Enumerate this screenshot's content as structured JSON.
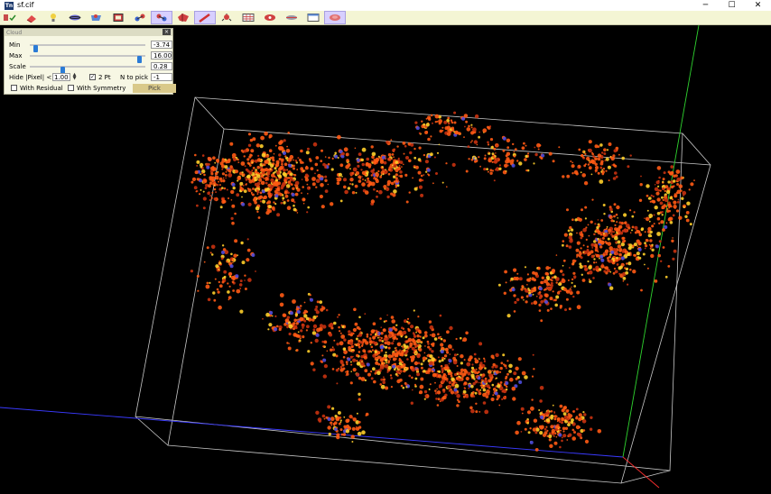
{
  "window": {
    "app_icon_text": "Tn",
    "title": "sf.cif",
    "minimize_glyph": "─",
    "maximize_glyph": "☐",
    "close_glyph": "✕"
  },
  "toolbar": {
    "buttons": [
      {
        "name": "structure-check-icon",
        "active": false
      },
      {
        "name": "eraser-icon",
        "active": false
      },
      {
        "name": "light-bulb-icon",
        "active": false
      },
      {
        "name": "ellipsoid-icon",
        "active": false
      },
      {
        "name": "packing-icon",
        "active": false
      },
      {
        "name": "unit-cell-box-icon",
        "active": false
      },
      {
        "name": "molecule-icon",
        "active": false
      },
      {
        "name": "atoms-selection-icon",
        "active": true
      },
      {
        "name": "polyhedron-icon",
        "active": false
      },
      {
        "name": "bond-pencil-icon",
        "active": true
      },
      {
        "name": "grow-tool-icon",
        "active": false
      },
      {
        "name": "grid-table-icon",
        "active": false
      },
      {
        "name": "hkl-view-icon",
        "active": false
      },
      {
        "name": "fourier-map-icon",
        "active": false
      },
      {
        "name": "window-layout-icon",
        "active": false
      },
      {
        "name": "cloud-density-icon",
        "active": true
      }
    ]
  },
  "panel": {
    "title": "Cloud",
    "close_glyph": "×",
    "min_label": "Min",
    "min_value": "-3.74",
    "min_slider_fraction": 0.03,
    "max_label": "Max",
    "max_value": "16.00",
    "max_slider_fraction": 0.97,
    "scale_label": "Scale",
    "scale_value": "0.28",
    "scale_slider_fraction": 0.28,
    "hide_label": "Hide |Pixel| <",
    "hide_value": "1.00",
    "two_pt_label": "2 Pt",
    "two_pt_checked": true,
    "check_glyph": "✓",
    "n_to_pick_label": "N to pick",
    "n_to_pick_value": "-1",
    "with_residual_label": "With Residual",
    "with_residual_checked": false,
    "with_symmetry_label": "With Symmetry",
    "with_symmetry_checked": false,
    "pick_label": "Pick"
  },
  "colors": {
    "background": "#000000",
    "cell_edges": "#c8c8c8",
    "axis_a": "#3a3aff",
    "axis_b": "#2fd42f",
    "axis_c": "#ff3030",
    "density_positive": "#ff5a14",
    "density_core": "#ffcf2a",
    "density_negative": "#4b4bdc"
  }
}
